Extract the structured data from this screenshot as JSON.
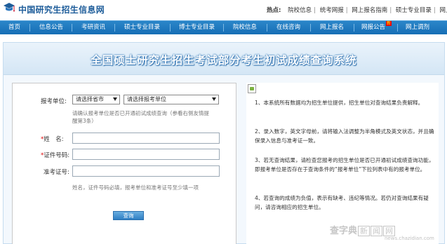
{
  "header": {
    "site_title": "中国研究生招生信息网",
    "hot_label": "热点:",
    "hot_links": [
      "院校信息",
      "统考网报",
      "网上报名指南",
      "硕士专业目录",
      "网上调"
    ]
  },
  "nav": {
    "items": [
      "首页",
      "信息公告",
      "考研资讯",
      "硕士专业目录",
      "博士专业目录",
      "院校信息",
      "在线咨询",
      "网上报名",
      "网报公告",
      "网上调剂"
    ],
    "new_badge": "新"
  },
  "banner": {
    "title": "全国硕士研究生招生考试部分考生初试成绩查询系统"
  },
  "form": {
    "unit_label": "报考单位:",
    "province_select": "请选择省市",
    "unit_select": "请选择报考单位",
    "unit_note": "请确认报考单位是否已开通初试成绩查询（参看右侧友情提醒第3条）",
    "name_label": "姓　名:",
    "id_label": "证件号码:",
    "ticket_label": "准考证号:",
    "ticket_note": "姓名，证件号码必填，报考单位和准考证号至少填一项",
    "query_button": "查询"
  },
  "info": {
    "items": [
      "1、本系统所有数据均为招生单位提供，招生单位对查询结果负责解释。",
      "2、录入数字，英文字母前，请将输入法调整为半角模式及英文状态，并且确保录入信息与准考证一致。",
      "3、若无查询结果，请检查您报考的招生单位是否已开通初试成绩查询功能，即报考单位是否存在于查询条件的“报考单位”下拉列表中有的报考单位。",
      "4、若查询的成绩为负值，表示有缺考、违纪等情况。若仍对查询结果有疑问，请咨询相应的招生单位。"
    ]
  },
  "watermark": {
    "text": "查字典",
    "boxed1": "新",
    "boxed2": "闻",
    "boxed3": "网",
    "sub": "news.chazidian.com"
  }
}
